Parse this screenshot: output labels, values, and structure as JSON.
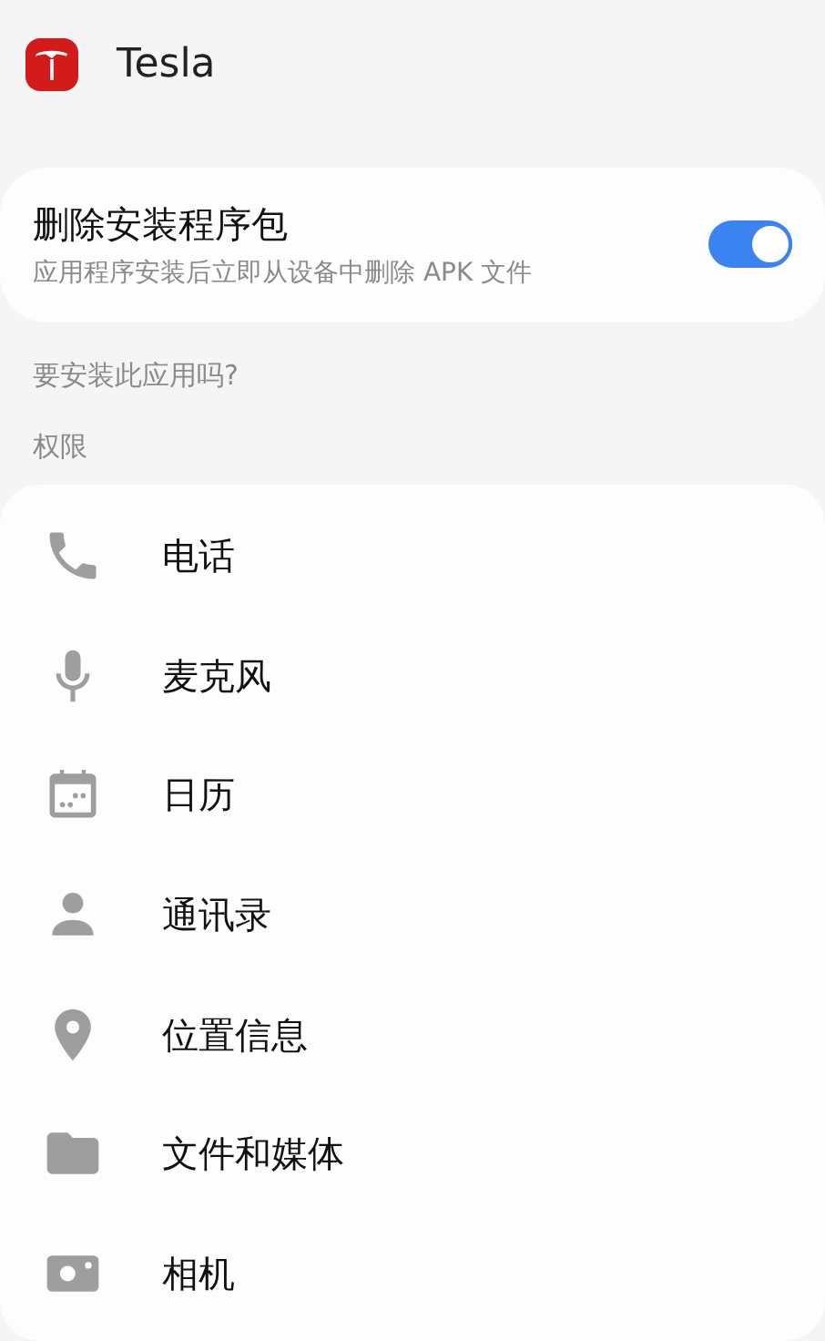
{
  "app": {
    "name": "Tesla"
  },
  "delete_package": {
    "title": "删除安装程序包",
    "subtitle": "应用程序安装后立即从设备中删除 APK 文件",
    "on": true
  },
  "prompt": "要安装此应用吗?",
  "permissions_header": "权限",
  "permissions": [
    {
      "kind": "phone",
      "label": "电话"
    },
    {
      "kind": "mic",
      "label": "麦克风"
    },
    {
      "kind": "calendar",
      "label": "日历"
    },
    {
      "kind": "contacts",
      "label": "通讯录"
    },
    {
      "kind": "location",
      "label": "位置信息"
    },
    {
      "kind": "folder",
      "label": "文件和媒体"
    },
    {
      "kind": "camera",
      "label": "相机"
    }
  ]
}
